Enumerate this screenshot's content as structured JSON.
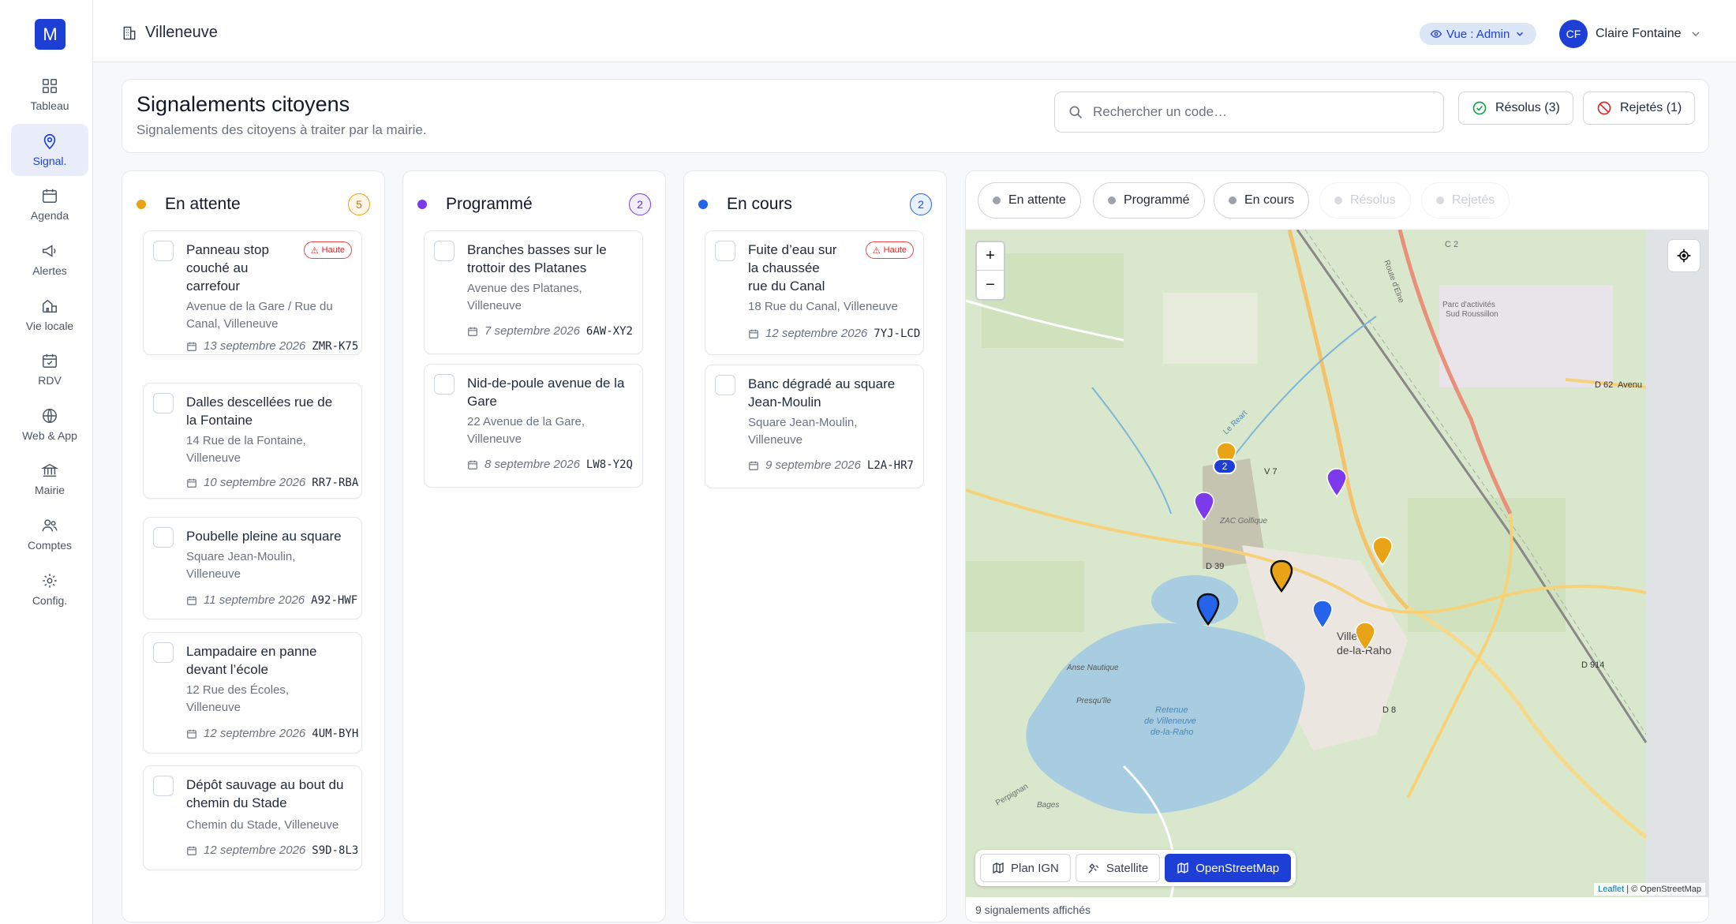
{
  "sidebar": {
    "logo": "M",
    "items": [
      {
        "label": "Tableau",
        "icon": "grid-icon"
      },
      {
        "label": "Signal.",
        "icon": "map-pin-icon",
        "active": true
      },
      {
        "label": "Agenda",
        "icon": "calendar-icon"
      },
      {
        "label": "Alertes",
        "icon": "megaphone-icon"
      },
      {
        "label": "Vie locale",
        "icon": "map-icon"
      },
      {
        "label": "RDV",
        "icon": "calendar-check-icon"
      },
      {
        "label": "Web & App",
        "icon": "globe-icon"
      },
      {
        "label": "Mairie",
        "icon": "bank-icon"
      },
      {
        "label": "Comptes",
        "icon": "users-icon"
      },
      {
        "label": "Config.",
        "icon": "gear-icon"
      }
    ]
  },
  "topbar": {
    "org_name": "Villeneuve",
    "view_label": "Vue : Admin",
    "user_initials": "CF",
    "user_name": "Claire Fontaine"
  },
  "header": {
    "title": "Signalements citoyens",
    "subtitle": "Signalements des citoyens à traiter par la mairie.",
    "search_placeholder": "Rechercher un code…",
    "resolved_button": "Résolus (3)",
    "rejected_button": "Rejetés (1)"
  },
  "columns": [
    {
      "title": "En attente",
      "count": "5",
      "color": "#e8a317",
      "cards": [
        {
          "title_lines": [
            "Panneau stop",
            "couché au",
            "carrefour"
          ],
          "addr_lines": [
            "Avenue de la Gare / Rue du",
            "Canal, Villeneuve"
          ],
          "date": "13 septembre 2026",
          "code": "ZMR-K75",
          "badge": "Haute"
        },
        {
          "title_lines": [
            "Dalles descellées rue de",
            "la Fontaine"
          ],
          "addr_lines": [
            "14 Rue de la Fontaine,",
            "Villeneuve"
          ],
          "date": "10 septembre 2026",
          "code": "RR7-RBA"
        },
        {
          "title_lines": [
            "Poubelle pleine au square"
          ],
          "addr_lines": [
            "Square Jean-Moulin,",
            "Villeneuve"
          ],
          "date": "11 septembre 2026",
          "code": "A92-HWF"
        },
        {
          "title_lines": [
            "Lampadaire en panne",
            "devant l’école"
          ],
          "addr_lines": [
            "12 Rue des Écoles,",
            "Villeneuve"
          ],
          "date": "12 septembre 2026",
          "code": "4UM-BYH"
        },
        {
          "title_lines": [
            "Dépôt sauvage au bout du",
            "chemin du Stade"
          ],
          "addr_lines": [
            "Chemin du Stade, Villeneuve"
          ],
          "date": "12 septembre 2026",
          "code": "S9D-8L3"
        }
      ]
    },
    {
      "title": "Programmé",
      "count": "2",
      "color": "#7c3aed",
      "cards": [
        {
          "title_lines": [
            "Branches basses sur le",
            "trottoir des Platanes"
          ],
          "addr_lines": [
            "Avenue des Platanes,",
            "Villeneuve"
          ],
          "date": "7 septembre 2026",
          "code": "6AW-XY2"
        },
        {
          "title_lines": [
            "Nid-de-poule avenue de la",
            "Gare"
          ],
          "addr_lines": [
            "22 Avenue de la Gare,",
            "Villeneuve"
          ],
          "date": "8 septembre 2026",
          "code": "LW8-Y2Q"
        }
      ]
    },
    {
      "title": "En cours",
      "count": "2",
      "color": "#2563eb",
      "cards": [
        {
          "title_lines": [
            "Fuite d’eau sur",
            "la chaussée",
            "rue du Canal"
          ],
          "addr_lines": [
            "18 Rue du Canal, Villeneuve"
          ],
          "date": "12 septembre 2026",
          "code": "7YJ-LCD",
          "badge": "Haute"
        },
        {
          "title_lines": [
            "Banc dégradé au square",
            "Jean-Moulin"
          ],
          "addr_lines": [
            "Square Jean-Moulin,",
            "Villeneuve"
          ],
          "date": "9 septembre 2026",
          "code": "L2A-HR7"
        }
      ]
    }
  ],
  "map": {
    "filters": [
      {
        "label": "En attente",
        "enabled": true
      },
      {
        "label": "Programmé",
        "enabled": true
      },
      {
        "label": "En cours",
        "enabled": true
      },
      {
        "label": "Résolus",
        "enabled": false
      },
      {
        "label": "Rejetés",
        "enabled": false
      }
    ],
    "zoom_in": "+",
    "zoom_out": "−",
    "layers": [
      {
        "label": "Plan IGN",
        "active": false
      },
      {
        "label": "Satellite",
        "active": false
      },
      {
        "label": "OpenStreetMap",
        "active": true
      }
    ],
    "attribution_leaflet": "Leaflet",
    "attribution_rest": " | © OpenStreetMap",
    "cluster_count": "2",
    "labels": [
      "C 2",
      "Route d'Elne",
      "Parc d'activités",
      "Sud Roussillon",
      "D 62",
      "Avenu",
      "Le Reart",
      "V 7",
      "ZAC Golfique",
      "D 39",
      "Villene",
      "de-la-Raho",
      "Anse Nautique",
      "Presqu'île",
      "Retenue",
      "de Villeneuve",
      "de-la-Raho",
      "D 8",
      "D 914",
      "Bages",
      "Perpignan"
    ],
    "footer": "9 signalements affichés"
  },
  "colors": {
    "accent": "#1d3fd6",
    "pending": "#e8a317",
    "scheduled": "#7c3aed",
    "in_progress": "#2563eb",
    "high_badge": "#ef4444"
  }
}
